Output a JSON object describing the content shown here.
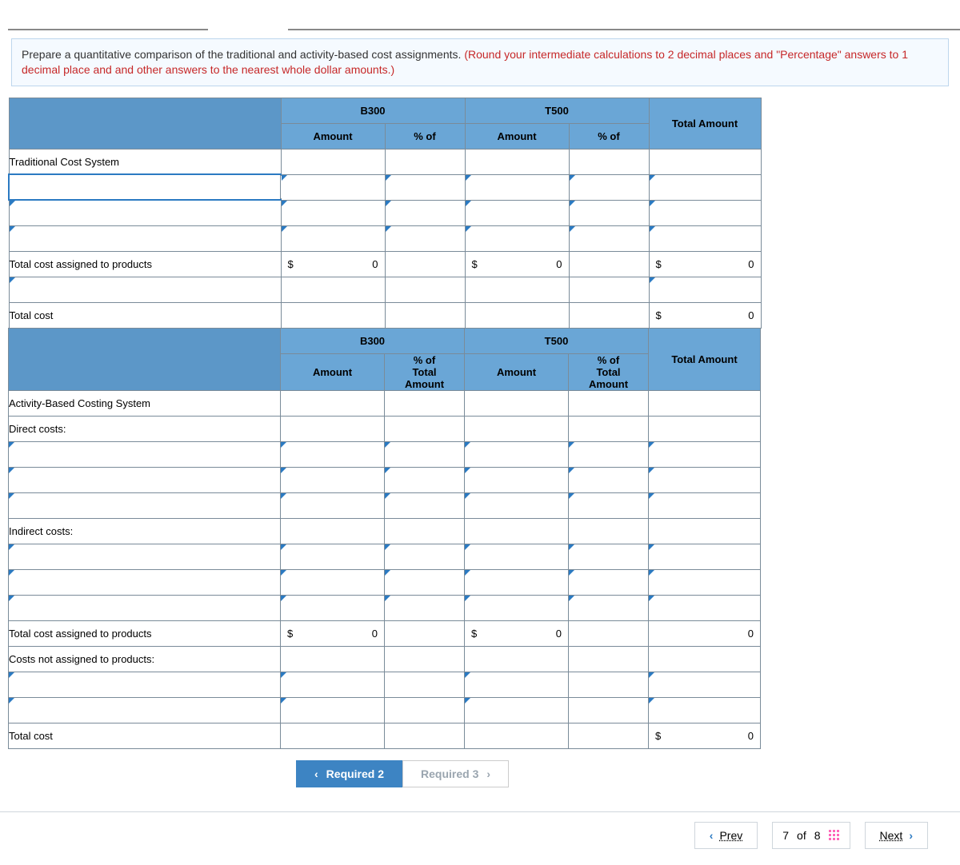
{
  "instructions": {
    "text_black": "Prepare a quantitative comparison of the traditional and activity-based cost assignments. ",
    "text_red": "(Round your intermediate calculations to 2 decimal places and \"Percentage\" answers to 1 decimal place and and other answers to the nearest whole dollar amounts.)"
  },
  "headers": {
    "b300": "B300",
    "t500": "T500",
    "amount": "Amount",
    "pct_of": "% of",
    "total_amount": "Total Amount",
    "pct_of_total_line1": "% of",
    "pct_of_total_line2": "Total",
    "pct_of_total_line3": "Amount"
  },
  "labels": {
    "traditional": "Traditional Cost System",
    "total_cost_assigned": "Total cost assigned to products",
    "total_cost": "Total cost",
    "abc": "Activity-Based Costing System",
    "direct_costs": "Direct costs:",
    "indirect_costs": "Indirect costs:",
    "costs_not_assigned": "Costs not assigned to products:"
  },
  "values": {
    "dollar": "$",
    "zero": "0"
  },
  "req_tabs": {
    "prev_label": "Required 2",
    "next_label": "Required 3"
  },
  "nav": {
    "prev": "Prev",
    "next": "Next",
    "page_current": "7",
    "page_of": "of",
    "page_total": "8"
  }
}
